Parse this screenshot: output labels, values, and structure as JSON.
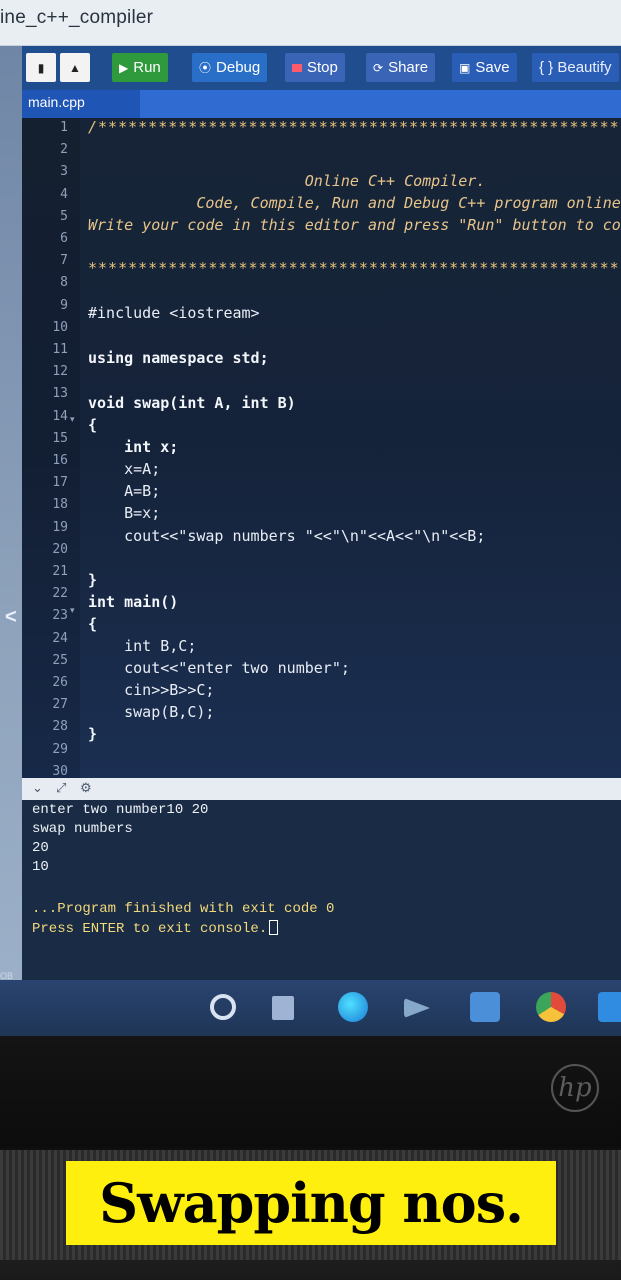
{
  "window": {
    "title": "ine_c++_compiler"
  },
  "toolbar": {
    "run_label": "Run",
    "debug_label": "Debug",
    "stop_label": "Stop",
    "share_label": "Share",
    "save_label": "Save",
    "beautify_label": "{ } Beautify"
  },
  "tabs": {
    "active_file": "main.cpp"
  },
  "editor": {
    "line_numbers": [
      "1",
      "2",
      "3",
      "4",
      "5",
      "6",
      "7",
      "8",
      "9",
      "10",
      "11",
      "12",
      "13",
      "14",
      "15",
      "16",
      "17",
      "18",
      "19",
      "20",
      "21",
      "22",
      "23",
      "24",
      "25",
      "26",
      "27",
      "28",
      "29",
      "30"
    ],
    "lines": {
      "l1": "/*****************************************************************",
      "l3": "                        Online C++ Compiler.",
      "l4": "            Code, Compile, Run and Debug C++ program online.",
      "l5": "Write your code in this editor and press \"Run\" button to compile and execute it.",
      "l7": "*******************************************************************",
      "l9": "#include <iostream>",
      "l11": "using namespace std;",
      "l13": "void swap(int A, int B)",
      "l14": "{",
      "l15": "    int x;",
      "l16": "    x=A;",
      "l17": "    A=B;",
      "l18": "    B=x;",
      "l19": "    cout<<\"swap numbers \"<<\"\\n\"<<A<<\"\\n\"<<B;",
      "l21": "}",
      "l22": "int main()",
      "l23": "{",
      "l24": "    int B,C;",
      "l25": "    cout<<\"enter two number\";",
      "l26": "    cin>>B>>C;",
      "l27": "    swap(B,C);",
      "l28": "}"
    }
  },
  "console": {
    "lines": [
      "enter two number10 20",
      "swap numbers",
      "20",
      "10"
    ],
    "finished": "...Program finished with exit code 0",
    "prompt": "Press ENTER to exit console."
  },
  "left_edge_label": "OB",
  "caption": "Swapping nos.",
  "laptop_logo": "hp",
  "colors": {
    "toolbar_bg": "#1f4d8e",
    "run_green": "#2e9a3b",
    "editor_bg": "#172437",
    "caption_bg": "#ffef0f"
  }
}
